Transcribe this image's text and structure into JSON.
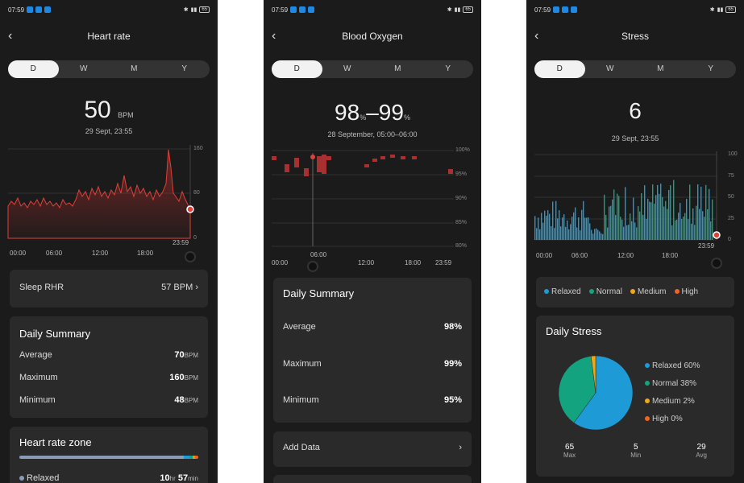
{
  "status": {
    "time": "07:59",
    "battery": "65"
  },
  "tabs": [
    "D",
    "W",
    "M",
    "Y"
  ],
  "heart": {
    "title": "Heart rate",
    "value": "50",
    "unit": "BPM",
    "date": "29 Sept, 23:55",
    "y_ticks": [
      "160",
      "80",
      "0"
    ],
    "x_ticks": [
      "00:00",
      "06:00",
      "12:00",
      "18:00"
    ],
    "end_time": "23:59",
    "sleep_label": "Sleep RHR",
    "sleep_value": "57 BPM",
    "summary_title": "Daily Summary",
    "rows": [
      {
        "label": "Average",
        "value": "70",
        "unit": "BPM"
      },
      {
        "label": "Maximum",
        "value": "160",
        "unit": "BPM"
      },
      {
        "label": "Minimum",
        "value": "48",
        "unit": "BPM"
      }
    ],
    "zone_title": "Heart rate zone",
    "zone_item": "Relaxed",
    "zone_h": "10",
    "zone_hu": "hr",
    "zone_m": "57",
    "zone_mu": "min"
  },
  "oxygen": {
    "title": "Blood Oxygen",
    "value_low": "98",
    "value_high": "99",
    "unit": "%",
    "date": "28 September, 05:00–06:00",
    "y_ticks": [
      "100%",
      "95%",
      "90%",
      "85%",
      "80%"
    ],
    "x_ticks": [
      "00:00",
      "06:00",
      "12:00",
      "18:00",
      "23:59"
    ],
    "summary_title": "Daily Summary",
    "rows": [
      {
        "label": "Average",
        "value": "98%"
      },
      {
        "label": "Maximum",
        "value": "99%"
      },
      {
        "label": "Minimum",
        "value": "95%"
      }
    ],
    "add_data": "Add Data"
  },
  "stress": {
    "title": "Stress",
    "value": "6",
    "date": "29 Sept, 23:55",
    "y_ticks": [
      "100",
      "75",
      "50",
      "25",
      "0"
    ],
    "x_ticks": [
      "00:00",
      "06:00",
      "12:00",
      "18:00"
    ],
    "end_time": "23:59",
    "legend": [
      {
        "label": "Relaxed",
        "color": "#1e9bd7"
      },
      {
        "label": "Normal",
        "color": "#14a37f"
      },
      {
        "label": "Medium",
        "color": "#f0a818"
      },
      {
        "label": "High",
        "color": "#f0641e"
      }
    ],
    "daily_title": "Daily Stress",
    "pie": [
      {
        "label": "Relaxed 60%",
        "pct": 60,
        "color": "#1e9bd7"
      },
      {
        "label": "Normal 38%",
        "pct": 38,
        "color": "#14a37f"
      },
      {
        "label": "Medium 2%",
        "pct": 2,
        "color": "#f0a818"
      },
      {
        "label": "High 0%",
        "pct": 0,
        "color": "#f0641e"
      }
    ],
    "stats": [
      {
        "value": "65",
        "label": "Max"
      },
      {
        "value": "5",
        "label": "Min"
      },
      {
        "value": "29",
        "label": "Avg"
      }
    ]
  }
}
